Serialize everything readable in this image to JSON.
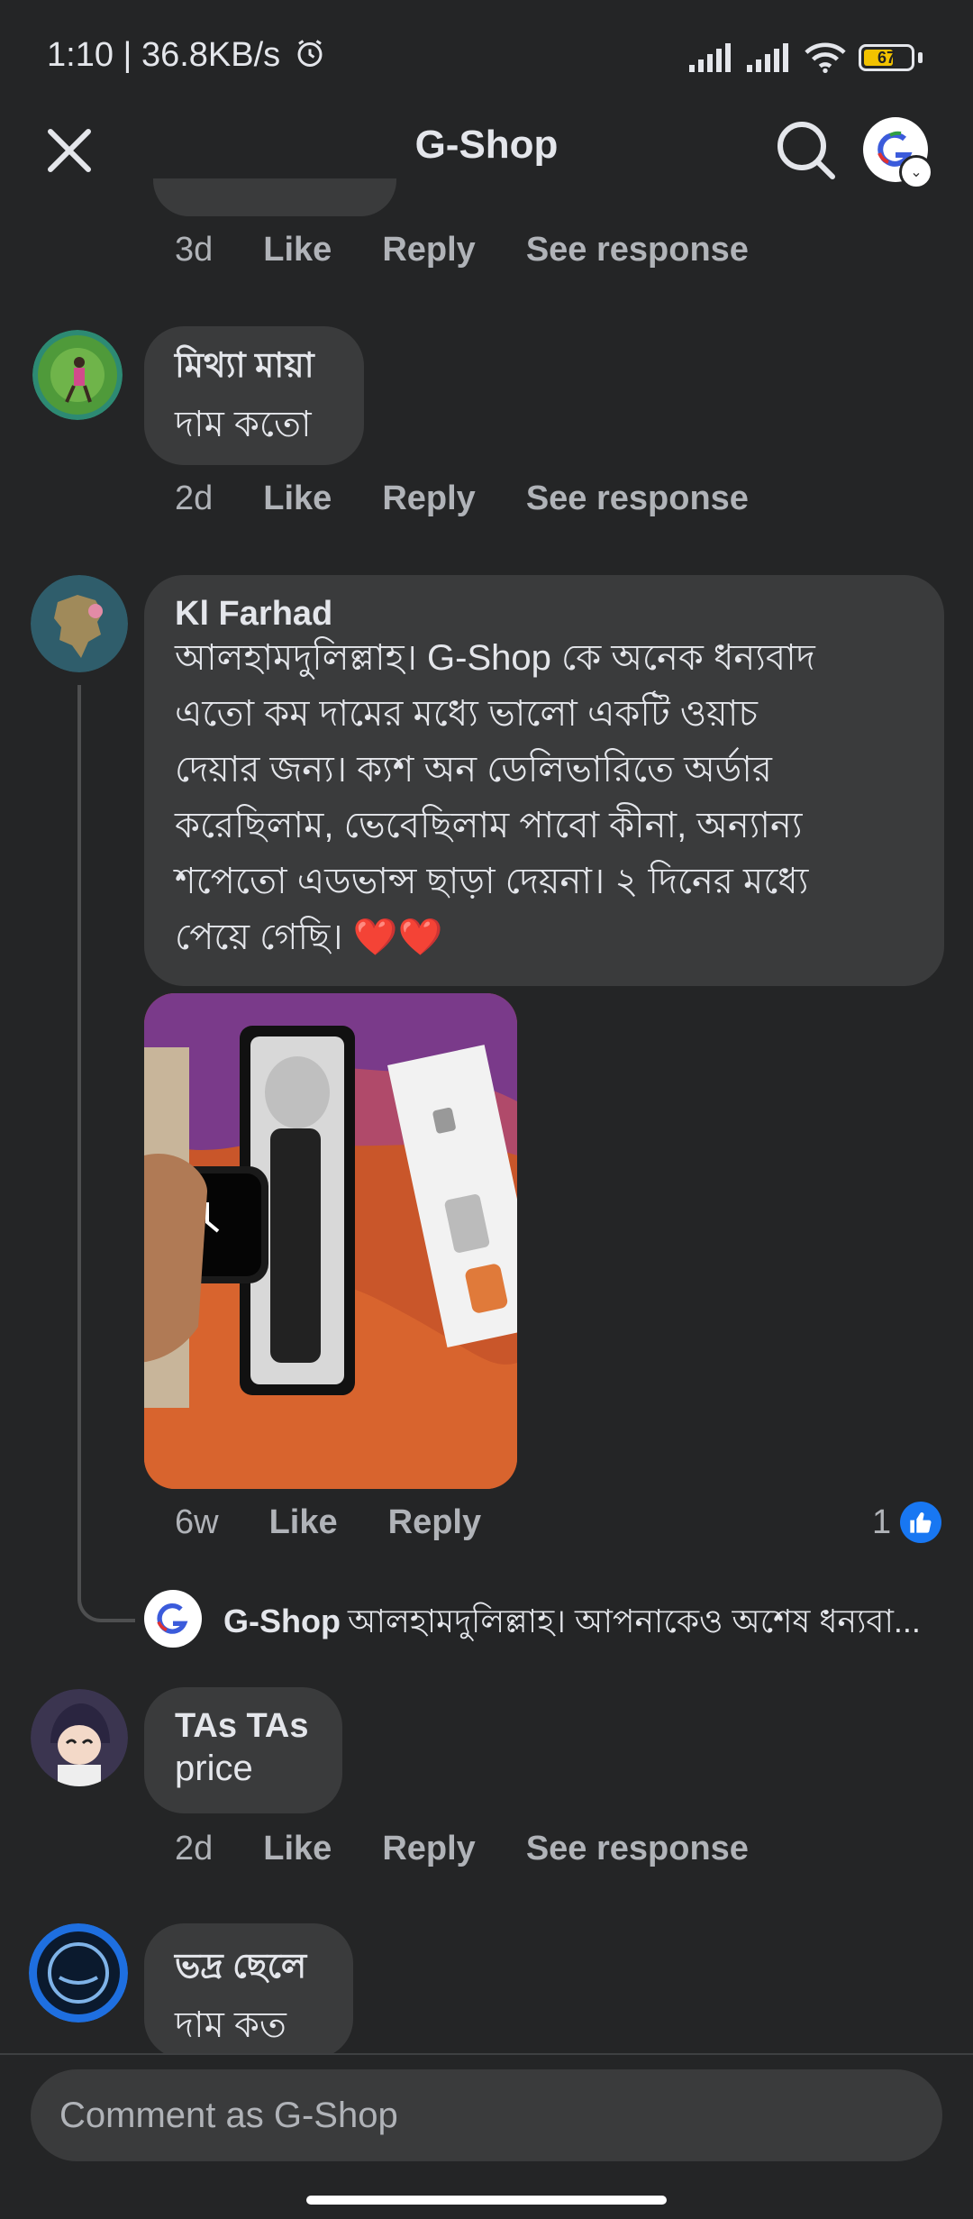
{
  "status_bar": {
    "time": "1:10 | 36.8KB/s",
    "alarm_icon": "alarm-icon",
    "battery_level": "67",
    "battery_fraction": 0.67
  },
  "header": {
    "title": "G-Shop"
  },
  "top_actions": {
    "time": "3d",
    "like": "Like",
    "reply": "Reply",
    "see_response": "See response"
  },
  "comments": [
    {
      "author": "মিথ্যা মায়া",
      "text": "দাম কতো",
      "time": "2d",
      "like": "Like",
      "reply": "Reply",
      "see_response": "See response"
    },
    {
      "author": "Kl Farhad",
      "text_lines": [
        "আলহামদুলিল্লাহ। G-Shop কে অনেক ধন্যবাদ",
        "এতো কম দামের মধ্যে ভালো একটি ওয়াচ",
        "দেয়ার জন্য। ক্যশ অন ডেলিভারিতে অর্ডার",
        "করেছিলাম, ভেবেছিলাম পাবো কীনা, অন্যান্য",
        "শপেতো এডভান্স ছাড়া দেয়না। ২ দিনের মধ্যে",
        "পেয়ে গেছি। ❤️❤️"
      ],
      "time": "6w",
      "like": "Like",
      "reply": "Reply",
      "reaction_count": "1",
      "reply_preview": {
        "author": "G-Shop",
        "text": "আলহামদুলিল্লাহ। আপনাকেও অশেষ ধন্যবা..."
      }
    },
    {
      "author": "TAs TAs",
      "text": "price",
      "time": "2d",
      "like": "Like",
      "reply": "Reply",
      "see_response": "See response"
    },
    {
      "author": "ভদ্র ছেলে",
      "text": "দাম কত"
    }
  ],
  "composer": {
    "placeholder": "Comment as G-Shop"
  },
  "colors": {
    "background": "#242526",
    "bubble": "#3a3b3c",
    "secondary_text": "#b0b3b8",
    "like_blue": "#1877f2"
  }
}
